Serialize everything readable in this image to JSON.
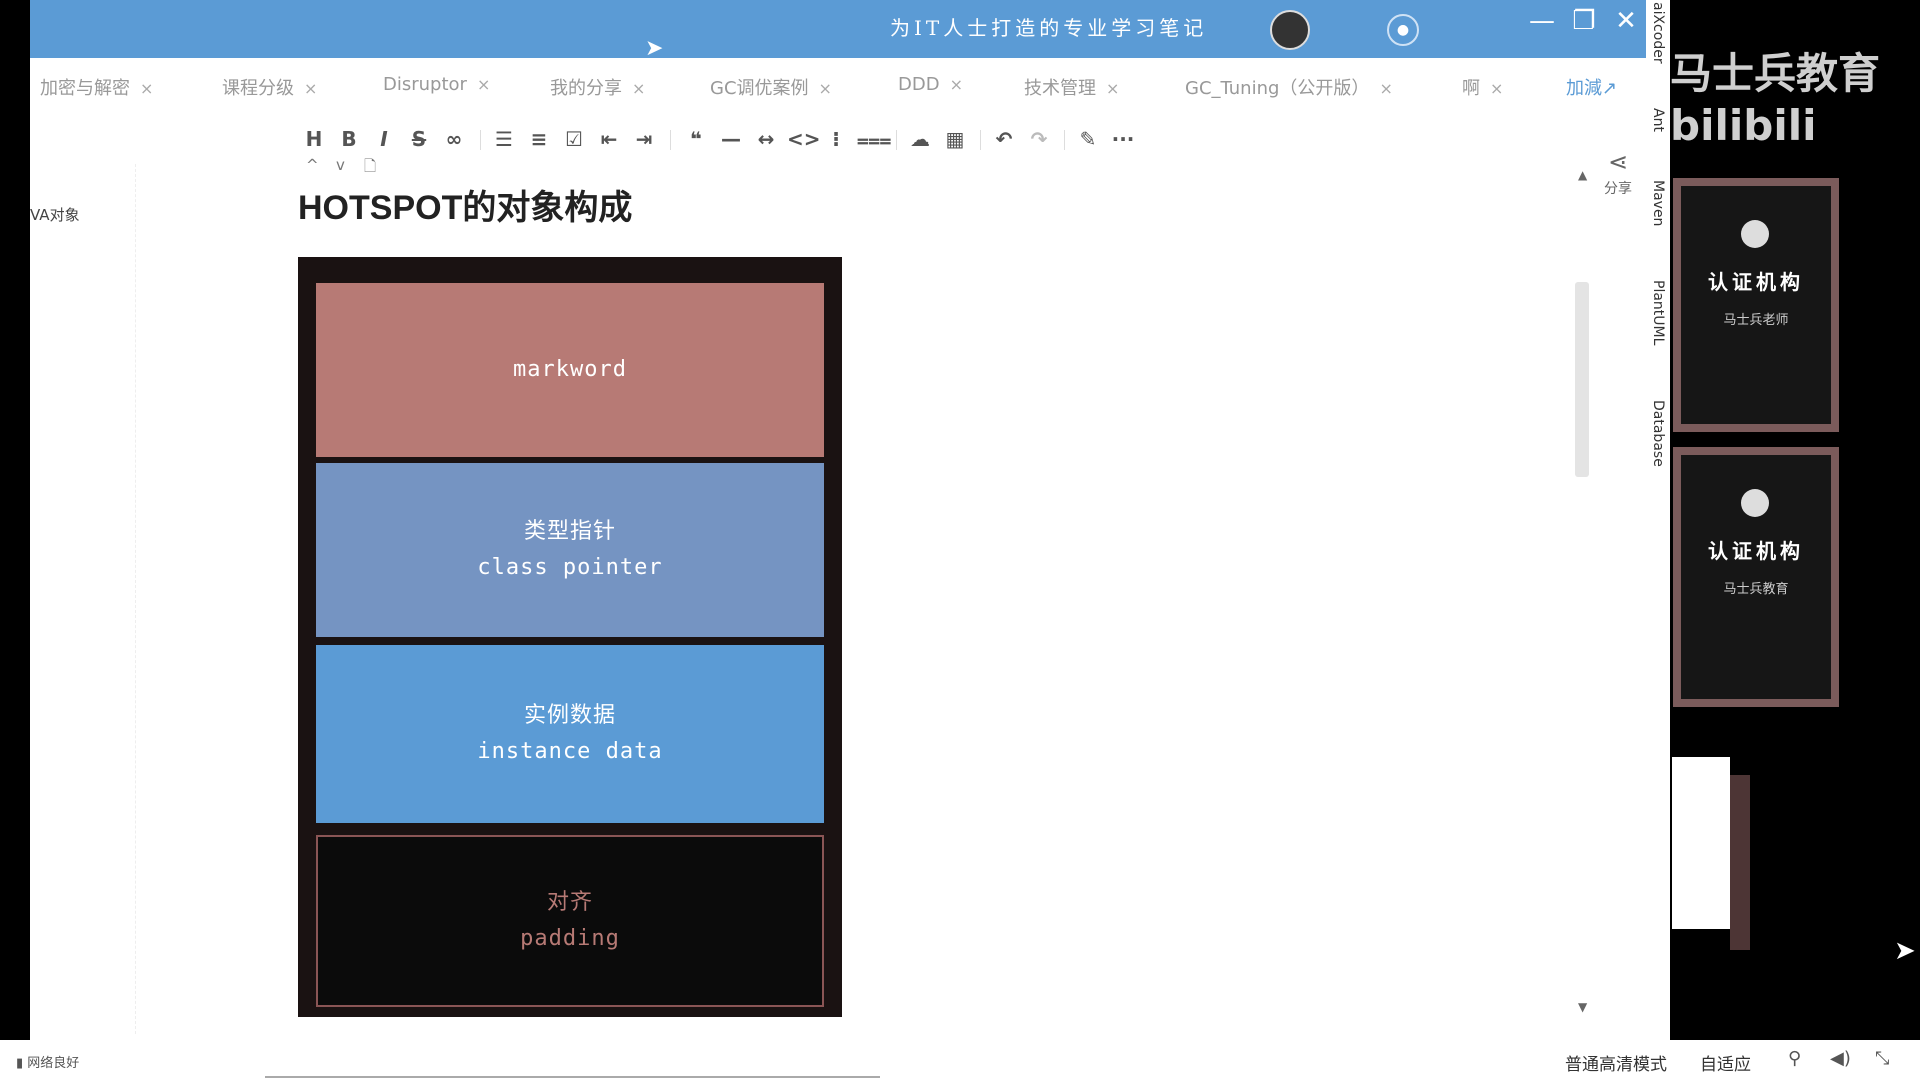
{
  "window": {
    "title": "为IT人士打造的专业学习笔记",
    "minimize": "—",
    "maximize": "❐",
    "close": "✕"
  },
  "tabs": [
    {
      "label": "加密与解密"
    },
    {
      "label": "课程分级"
    },
    {
      "label": "Disruptor"
    },
    {
      "label": "我的分享"
    },
    {
      "label": "GC调优案例"
    },
    {
      "label": "DDD"
    },
    {
      "label": "技术管理"
    },
    {
      "label": "GC_Tuning（公开版）"
    },
    {
      "label": "啊"
    },
    {
      "label": "加減↗"
    }
  ],
  "toolbar": {
    "items": [
      "H",
      "B",
      "I",
      "S",
      "∞",
      "☰",
      "≡",
      "☑",
      "⇤",
      "⇥",
      "❝",
      "—",
      "↔",
      "<>",
      "⁝",
      "⩶",
      "☁",
      "▦",
      "↶",
      "↷",
      "✎",
      "···"
    ],
    "extra": [
      "^",
      "v",
      "🗋"
    ]
  },
  "outline": {
    "item": "VA对象"
  },
  "document": {
    "heading": "HOTSPOT的对象构成",
    "blocks": {
      "markword": {
        "line1": "markword"
      },
      "class_pointer": {
        "line1": "类型指针",
        "line2": "class pointer"
      },
      "instance_data": {
        "line1": "实例数据",
        "line2": "instance data"
      },
      "padding": {
        "line1": "对齐",
        "line2": "padding"
      }
    }
  },
  "sidebar_right": {
    "share_label": "分享",
    "labels": [
      "aiXcoder",
      "Ant",
      "Maven",
      "PlantUML",
      "Database"
    ]
  },
  "overlay": {
    "watermark": "马士兵教育 bilibili",
    "cert1_title": "认证机构",
    "cert1_sub": "马士兵老师",
    "cert2_title": "认证机构",
    "cert2_sub": "马士兵教育"
  },
  "bottom_bar": {
    "network": "网络良好",
    "quality": "普通高清模式",
    "fit": "自适应"
  },
  "colors": {
    "title_bar": "#5b9bd5",
    "markword": "#b77a75",
    "class_pointer": "#7594c2",
    "instance_data": "#5b9bd5",
    "padding": "#0b0b0b"
  }
}
